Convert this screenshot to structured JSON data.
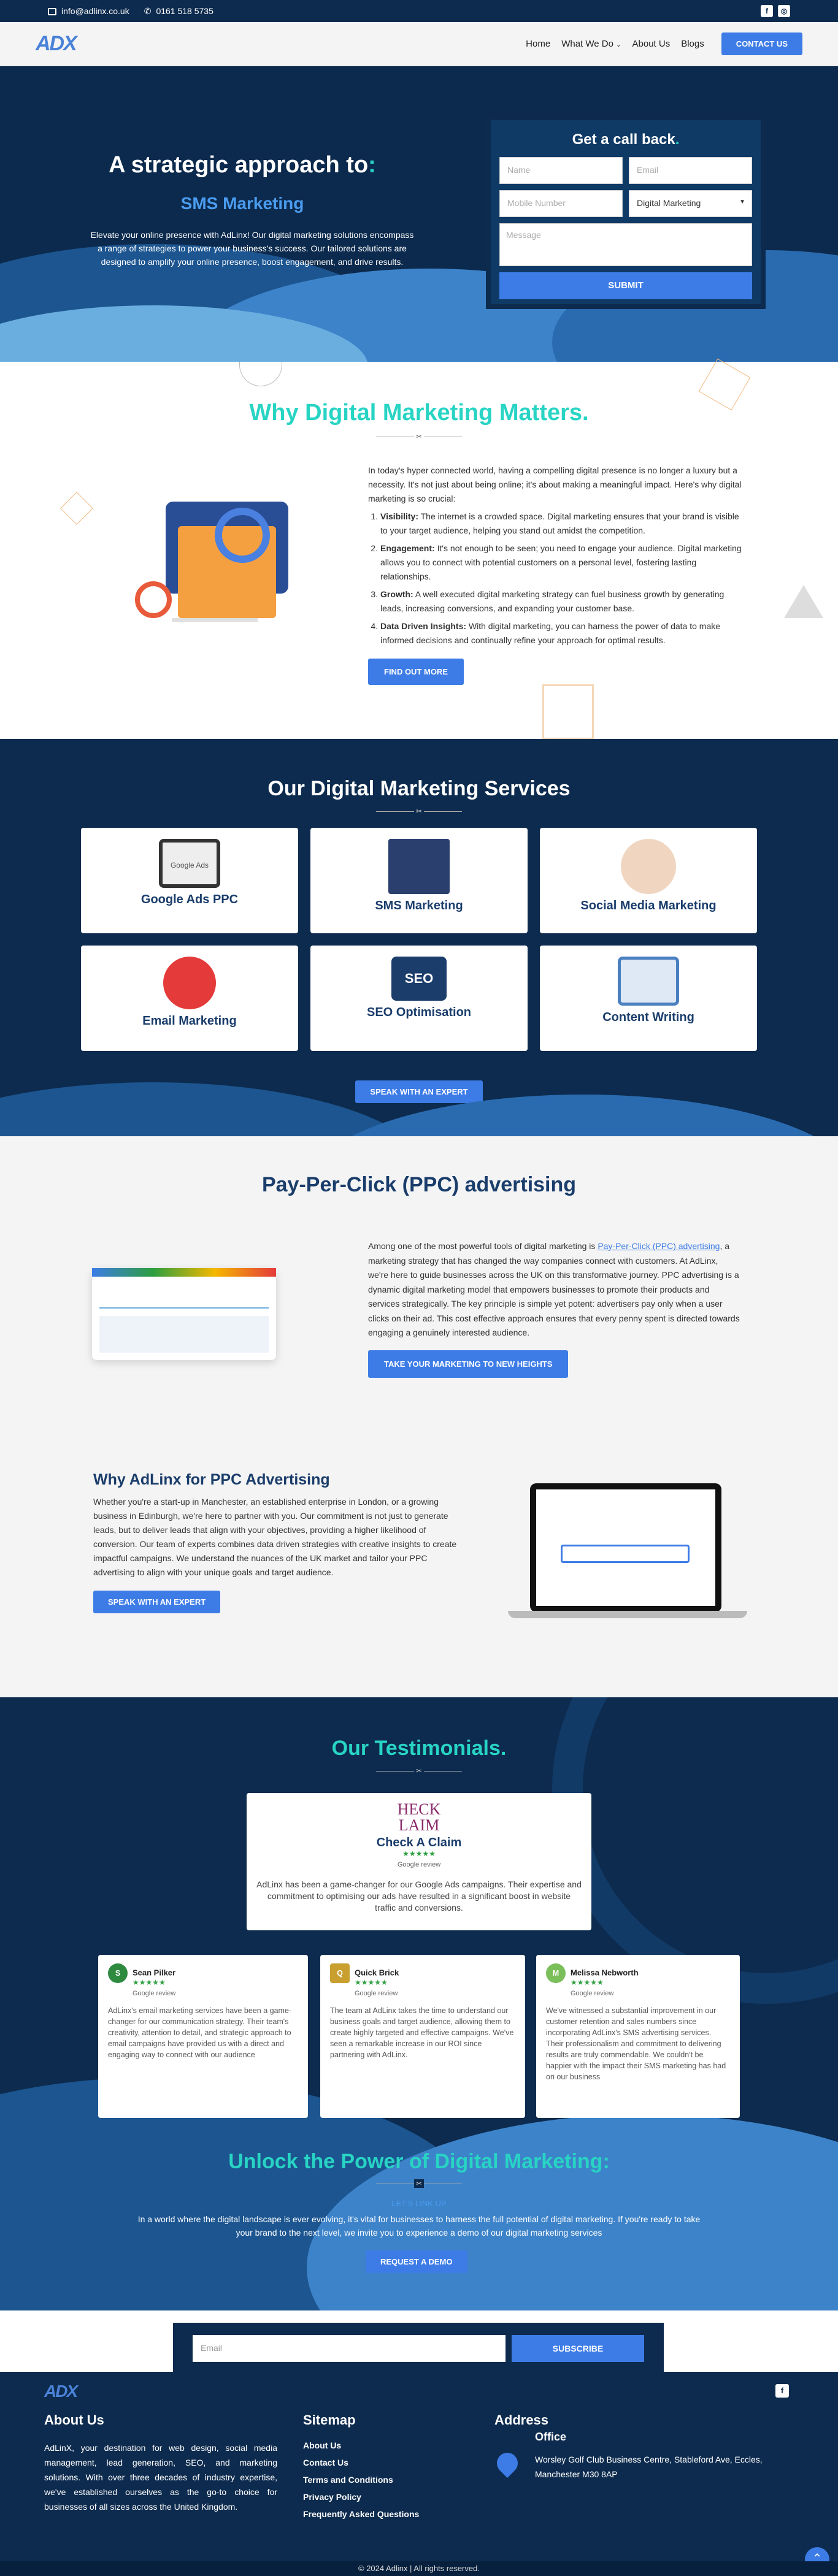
{
  "topbar": {
    "email": "info@adlinx.co.uk",
    "phone": "0161 518 5735"
  },
  "nav": {
    "logo": "ADX",
    "items": [
      "Home",
      "What We Do",
      "About Us",
      "Blogs"
    ],
    "cta": "CONTACT US"
  },
  "hero": {
    "title": "A strategic approach to",
    "title_colon": ":",
    "subtitle": "SMS Marketing",
    "desc": "Elevate your online presence with AdLinx! Our digital marketing solutions encompass a range of strategies to power your business's success. Our tailored solutions are designed to amplify your online presence, boost engagement, and drive results."
  },
  "callback": {
    "title": "Get a call back",
    "dot": ".",
    "name": "Name",
    "email": "Email",
    "mobile": "Mobile Number",
    "service": "Digital Marketing",
    "message": "Message",
    "submit": "SUBMIT"
  },
  "why": {
    "title": "Why Digital Marketing Matters",
    "dot": ".",
    "intro": "In today's hyper connected world, having a compelling digital presence is no longer a luxury but a necessity. It's not just about being online; it's about making a meaningful impact. Here's why digital marketing is so crucial:",
    "points": [
      {
        "head": "Visibility:",
        "text": " The internet is a crowded space. Digital marketing ensures that your brand is visible to your target audience, helping you stand out amidst the competition."
      },
      {
        "head": "Engagement:",
        "text": " It's not enough to be seen; you need to engage your audience. Digital marketing allows you to connect with potential customers on a personal level, fostering lasting relationships."
      },
      {
        "head": "Growth:",
        "text": " A well executed digital marketing strategy can fuel business growth by generating leads, increasing conversions, and expanding your customer base."
      },
      {
        "head": "Data Driven Insights:",
        "text": " With digital marketing, you can harness the power of data to make informed decisions and continually refine your approach for optimal results."
      }
    ],
    "cta": "FIND OUT MORE"
  },
  "services": {
    "title": "Our Digital Marketing Services",
    "items": [
      "Google Ads PPC",
      "SMS Marketing",
      "Social Media Marketing",
      "Email Marketing",
      "SEO Optimisation",
      "Content Writing"
    ],
    "icon_text": {
      "ads": "Google Ads",
      "seo": "SEO"
    },
    "cta": "SPEAK WITH AN EXPERT"
  },
  "ppc": {
    "title": "Pay-Per-Click (PPC) advertising",
    "pre": "Among one of the most powerful tools of digital marketing is ",
    "link": "Pay-Per-Click (PPC) advertising",
    "post": ", a marketing strategy that has changed the way companies connect with customers. At AdLinx, we're here to guide businesses across the UK on this transformative journey. PPC advertising is a dynamic digital marketing model that empowers businesses to promote their products and services strategically. The key principle is simple yet potent: advertisers pay only when a user clicks on their ad. This cost effective approach ensures that every penny spent is directed towards engaging a genuinely interested audience.",
    "cta": "TAKE YOUR MARKETING TO NEW HEIGHTS"
  },
  "why_ppc": {
    "title": "Why AdLinx for PPC Advertising",
    "text": "Whether you're a start-up in Manchester, an established enterprise in London, or a growing business in Edinburgh, we're here to partner with you. Our commitment is not just to generate leads, but to deliver leads that align with your objectives, providing a higher likelihood of conversion. Our team of experts combines data driven strategies with creative insights to create impactful campaigns. We understand the nuances of the UK market and tailor your PPC advertising to align with your unique goals and target audience.",
    "cta": "SPEAK WITH AN EXPERT"
  },
  "testimonials": {
    "title": "Our Testimonials",
    "dot": ".",
    "featured": {
      "logo": "HECK LAIM",
      "name": "Check A Claim",
      "stars": "★★★★★",
      "source": "Google review",
      "text": "AdLinx has been a game-changer for our Google Ads campaigns. Their expertise and commitment to optimising our ads have resulted in a significant boost in website traffic and conversions."
    },
    "items": [
      {
        "initial": "S",
        "name": "Sean Pilker",
        "stars": "★★★★★",
        "source": "Google review",
        "text": "AdLinx's email marketing services have been a game-changer for our communication strategy. Their team's creativity, attention to detail, and strategic approach to email campaigns have provided us with a direct and engaging way to connect with our audience"
      },
      {
        "initial": "Q",
        "name": "Quick Brick",
        "stars": "★★★★★",
        "source": "Google review",
        "text": "The team at AdLinx takes the time to understand our business goals and target audience, allowing them to create highly targeted and effective campaigns. We've seen a remarkable increase in our ROI since partnering with AdLinx."
      },
      {
        "initial": "M",
        "name": "Melissa Nebworth",
        "stars": "★★★★★",
        "source": "Google review",
        "text": "We've witnessed a substantial improvement in our customer retention and sales numbers since incorporating AdLinx's SMS advertising services. Their professionalism and commitment to delivering results are truly commendable. We couldn't be happier with the impact their SMS marketing has had on our business"
      }
    ]
  },
  "unlock": {
    "title": "Unlock the Power of Digital Marketing",
    "colon": ":",
    "tag": "LET'S LINK UP",
    "text": "In a world where the digital landscape is ever evolving, it's vital for businesses to harness the full potential of digital marketing. If you're ready to take your brand to the next level, we invite you to experience a demo of our digital marketing services",
    "cta": "REQUEST A DEMO"
  },
  "newsletter": {
    "placeholder": "Email",
    "button": "SUBSCRIBE"
  },
  "footer": {
    "logo": "ADX",
    "about_title": "About Us",
    "about_text": "AdLinX, your destination for web design, social media management, lead generation, SEO, and marketing solutions. With over three decades of industry expertise, we've established ourselves as the go-to choice for businesses of all sizes across the United Kingdom.",
    "sitemap_title": "Sitemap",
    "sitemap": [
      "About Us",
      "Contact Us",
      "Terms and Conditions",
      "Privacy Policy",
      "Frequently Asked Questions"
    ],
    "address_title": "Address",
    "office_title": "Office",
    "office": "Worsley Golf Club Business Centre, Stableford Ave, Eccles, Manchester M30 8AP",
    "copyright": "© 2024 Adlinx | All rights reserved."
  }
}
